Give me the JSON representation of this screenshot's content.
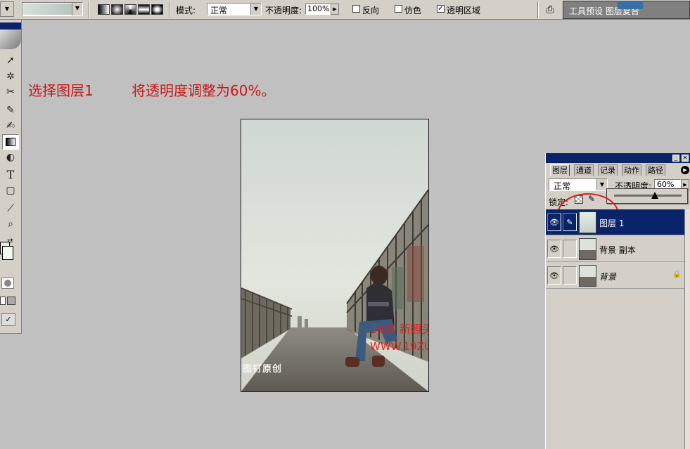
{
  "options_bar": {
    "mode_label": "模式:",
    "mode_value": "正常",
    "opacity_label": "不透明度:",
    "opacity_value": "100%",
    "reverse_label": "反向",
    "dither_label": "仿色",
    "transparency_label": "透明区域",
    "reverse_checked": false,
    "dither_checked": false,
    "transparency_checked": true,
    "palette_well_text": "工具预设  图层复合"
  },
  "toolbox": {
    "tools": [
      "move-icon",
      "magic-wand-icon",
      "lasso-icon",
      "brush-icon",
      "history-brush-icon",
      "gradient-icon",
      "dodge-icon",
      "type-icon",
      "shape-icon",
      "eyedropper-icon",
      "zoom-icon"
    ]
  },
  "annotations": {
    "step_text": "选择图层1",
    "instruction_text": "将透明度调整为60%。"
  },
  "document": {
    "watermark_line1": "19组    新照头  原创教程",
    "watermark_line2": "WWW.19ZU.COM",
    "corner_logo_text": "图钉原创"
  },
  "layers_panel": {
    "tabs": [
      "图层",
      "通道",
      "记录",
      "动作",
      "路径"
    ],
    "active_tab": "图层",
    "blend_mode": "正常",
    "opacity_label": "不透明度:",
    "opacity_value": "60%",
    "lock_label": "锁定:",
    "layers": [
      {
        "name": "图层 1",
        "selected": true,
        "visible": true,
        "locked": false
      },
      {
        "name": "背景 副本",
        "selected": false,
        "visible": true,
        "locked": false
      },
      {
        "name": "背景",
        "selected": false,
        "visible": true,
        "locked": true
      }
    ]
  },
  "colors": {
    "annotation_red": "#cc1616",
    "selection_blue": "#0a246a",
    "ui_gray": "#d4d0c8",
    "workspace_gray": "#c0c0c0"
  }
}
